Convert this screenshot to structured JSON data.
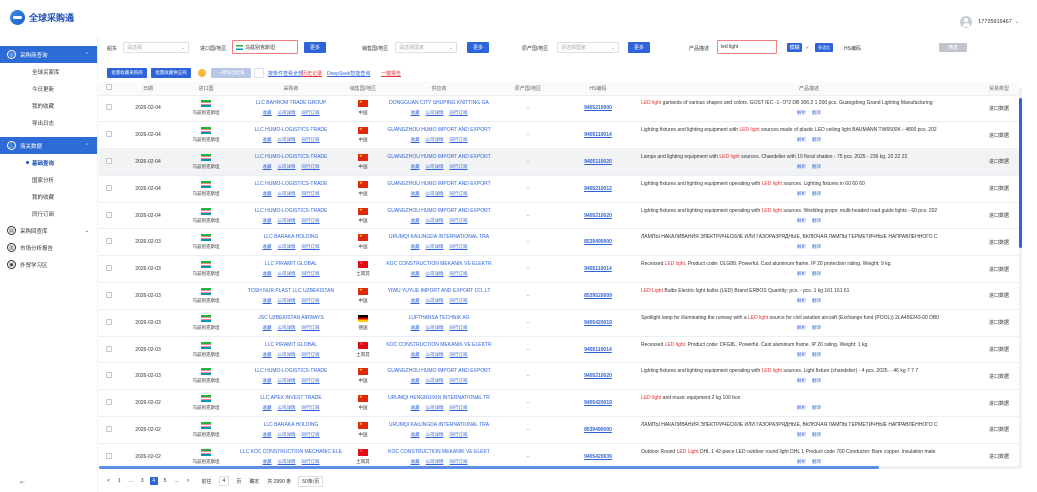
{
  "app": {
    "title": "全球采购通",
    "user_phone": "17725916467"
  },
  "sidebar": {
    "groups": [
      {
        "label": "采购商查询",
        "active": true,
        "items": [
          "全球买家库",
          "今日更新",
          "我的收藏",
          "导出日志"
        ]
      },
      {
        "label": "海关数据",
        "active": true,
        "items": [
          "基础查询",
          "国家分析",
          "我的收藏",
          "同行订阅"
        ]
      },
      {
        "label": "采购回查库"
      },
      {
        "label": "市场分析报告"
      },
      {
        "label": "外贸学习区"
      }
    ],
    "active_item": "基础查询",
    "footer_icon": "collapse-icon"
  },
  "filters": {
    "l1": "船东",
    "i1_ph": "请选择",
    "l2": "进口国/地区",
    "i2_val": "乌兹别克斯坦",
    "b2": "更多",
    "l3": "销售国/地区",
    "i3_ph": "请选择国家",
    "b3": "更多",
    "l4": "原产国/地区",
    "i4_ph": "请选择国家",
    "b4": "更多",
    "l5": "产品描述",
    "i5_val": "led light",
    "chip1": "模糊",
    "chip2": "多语言",
    "l6": "HS编码",
    "chip3": "筛选"
  },
  "toolbar": {
    "btn1": "批量收藏采购商",
    "btn2": "批量收藏供应商",
    "btn3": "一键导出结果",
    "link1": "按条件查看全部",
    "link2": "历史记录",
    "link3": "DeepSeek智能查询",
    "link4": "一键报告"
  },
  "table": {
    "headers": [
      "日期",
      "进口国",
      "采购商",
      "销售国/地区",
      "供应商",
      "原产国/地区",
      "HS编码",
      "产品描述",
      "贸易类型"
    ],
    "actions": [
      "收藏",
      "公司详情",
      "同行订阅"
    ],
    "desc_actions": [
      "解析",
      "翻译"
    ],
    "rows": [
      {
        "date": "2026-02-04",
        "imp": "乌兹别克斯坦",
        "buyer": "LLC BAHROM TRADE GROUP",
        "sc": "中国",
        "supplier": "DONGGUAN CITY SHUPING KNITTING GA",
        "oc": "-",
        "hs": "9405210000",
        "d1": "",
        "kw": "LED light",
        "d2": " garlands of various shapes and colors. GOST IEC -1- O*2 DB 306.2 1 200 pcs. Guangdong Grand Lighting Manufacturing",
        "type": "进口数据",
        "flag": "cn"
      },
      {
        "date": "2026-02-04",
        "imp": "乌兹别克斯坦",
        "buyer": "LLC HUMO-LOGISTICS-TRADE",
        "sc": "中国",
        "supplier": "GUANGZHOU HUMO IMPORT AND EXPORT",
        "oc": "-",
        "hs": "9405110014",
        "d1": "Lighting fixtures and lighting equipment with ",
        "kw": "LED light",
        "d2": " sources made of plastic LED ceiling light BAUMANN TW6500K - 4800 pcs. 202",
        "type": "进口数据",
        "flag": "cn"
      },
      {
        "date": "2026-02-04",
        "imp": "乌兹别克斯坦",
        "buyer": "LLC HUMO-LOGISTICS-TRADE",
        "sc": "中国",
        "supplier": "GUANGZHOU HUMO IMPORT AND EXPORT",
        "oc": "-",
        "hs": "9405110020",
        "d1": "Lamps and lighting equipment with ",
        "kw": "LED light",
        "d2": " sources. Chandelier with 10 floral shades - 75 pcs. 2025 - 236 kg. 22 22 22",
        "type": "进口数据",
        "flag": "cn"
      },
      {
        "date": "2026-02-04",
        "imp": "乌兹别克斯坦",
        "buyer": "LLC HUMO-LOGISTICS-TRADE",
        "sc": "中国",
        "supplier": "GUANGZHOU HUMO IMPORT AND EXPORT",
        "oc": "-",
        "hs": "9405210012",
        "d1": "Lighting fixtures and lighting equipment operating with ",
        "kw": "LED light",
        "d2": " sources. Lighting fixtures in 60 60 60",
        "type": "进口数据",
        "flag": "cn"
      },
      {
        "date": "2026-02-04",
        "imp": "乌兹别克斯坦",
        "buyer": "LLC HUMO-LOGISTICS-TRADE",
        "sc": "中国",
        "supplier": "GUANGZHOU HUMO IMPORT AND EXPORT",
        "oc": "-",
        "hs": "9405210020",
        "d1": "Lighting fixtures and lighting equipment operating with ",
        "kw": "LED light",
        "d2": " sources. Wedding props: multi-headed road guide lights - 60 pcs. 202",
        "type": "进口数据",
        "flag": "cn"
      },
      {
        "date": "2026-02-03",
        "imp": "乌兹别克斯坦",
        "buyer": "LLC BARAKA HOLDING",
        "sc": "中国",
        "supplier": "URUMQI KAILINGDA INTERNATIONAL TRA",
        "oc": "-",
        "hs": "8539490000",
        "d1": "ЛАМПЫ НАКАЛИВАНИЯ ЭЛЕКТРИЧЕСКИЕ ИЛИ ГАЗОРАЗРЯДНЫЕ, ВКЛЮЧАЯ ЛАМПЫ ГЕРМЕТИЧНЫЕ НАПРАВЛЕННОГО С",
        "kw": "",
        "d2": "",
        "type": "进口数据",
        "flag": "cn"
      },
      {
        "date": "2026-02-03",
        "imp": "乌兹别克斯坦",
        "buyer": "LLC PIRAMIT GLOBAL",
        "sc": "土耳其",
        "supplier": "KOC CONSTRUCTION MEKANIK VE ELEKTR",
        "oc": "-",
        "hs": "9405110014",
        "d1": "Recessed ",
        "kw": "LED light",
        "d2": ". Product code: DLG88. Powerful. Cast aluminum frame. IP 20 protection rating. Weight: 9 kg.",
        "type": "进口数据",
        "flag": "tr"
      },
      {
        "date": "2026-02-03",
        "imp": "乌兹别克斯坦",
        "buyer": "TOSH NUR PLAST LLC UZBEKISTAN",
        "sc": "中国",
        "supplier": "YIWU YUYUE IMPORT AND EXPORT CO.,LT",
        "oc": "-",
        "hs": "8539520009",
        "d1": "",
        "kw": "LED Light",
        "d2": " Bulbs Electric light bulbs (LED) Brand ERBOS Quantity: pcs. - pcs. 1 kg 161 161 61",
        "type": "进口数据",
        "flag": "cn"
      },
      {
        "date": "2026-02-03",
        "imp": "乌兹别克斯坦",
        "buyer": "JSC UZBEKISTAN AIRWAYS",
        "sc": "德国",
        "supplier": "LUFTHANSA TECHNIK AG",
        "oc": "-",
        "hs": "9405420019",
        "d1": "Spotlight lamp for illuminating the runway with a ",
        "kw": "LED light",
        "d2": " source for civil aviation aircraft (Exchange fund (POOL)) 2LA456243-00 DB0",
        "type": "进口数据",
        "flag": "de"
      },
      {
        "date": "2026-02-03",
        "imp": "乌兹别克斯坦",
        "buyer": "LLC PIRAMIT GLOBAL",
        "sc": "土耳其",
        "supplier": "KOC CONSTRUCTION MEKANIK VE ELEKTR",
        "oc": "-",
        "hs": "9405110014",
        "d1": "Recessed ",
        "kw": "LED light",
        "d2": ". Product code: DFG8L. Powerful. Cast aluminum frame. IP 20 rating. Weight: 1 kg.",
        "type": "进口数据",
        "flag": "tr"
      },
      {
        "date": "2026-02-03",
        "imp": "乌兹别克斯坦",
        "buyer": "LLC HUMO-LOGISTICS-TRADE",
        "sc": "中国",
        "supplier": "GUANGZHOU HUMO IMPORT AND EXPORT",
        "oc": "-",
        "hs": "9405210020",
        "d1": "Lighting fixtures and lighting equipment operating with ",
        "kw": "LED light",
        "d2": " sources. Light fixture (chandelier) - 4 pcs. 2025. - 46 kg 7 7 7",
        "type": "进口数据",
        "flag": "cn"
      },
      {
        "date": "2026-02-02",
        "imp": "乌兹别克斯坦",
        "buyer": "LLC APEX INVEST TRADE",
        "sc": "中国",
        "supplier": "URUMQI HENGRUIXIN INTERNATIONAL TR",
        "oc": "-",
        "hs": "9405420019",
        "d1": "",
        "kw": "LED light",
        "d2": " and music equipment 2 kg 100 box",
        "type": "进口数据",
        "flag": "cn"
      },
      {
        "date": "2026-02-02",
        "imp": "乌兹别克斯坦",
        "buyer": "LLC BARAKA HOLDING",
        "sc": "中国",
        "supplier": "URUMQI KAILINGDA INTERNATIONAL TRA",
        "oc": "-",
        "hs": "8539490000",
        "d1": "ЛАМПЫ НАКАЛИВАНИЯ ЭЛЕКТРИЧЕСКИЕ ИЛИ ГАЗОРАЗРЯДНЫЕ, ВКЛЮЧАЯ ЛАМПЫ ГЕРМЕТИЧНЫЕ НАПРАВЛЕННОГО С",
        "kw": "",
        "d2": "",
        "type": "进口数据",
        "flag": "cn"
      },
      {
        "date": "2026-02-02",
        "imp": "乌兹别克斯坦",
        "buyer": "LLC KOC CONSTRUCTION MECHANIC ELE",
        "sc": "土耳其",
        "supplier": "KOC CONSTRUCTION MEKANIK VE ELEKT",
        "oc": "-",
        "hs": "9405420039",
        "d1": "Outdoor Round ",
        "kw": "LED Light",
        "d2": " DHL 1 42-piece LED outdoor round light DHL 1 Product code 760 Conductor: Bare copper. Insulation mate",
        "type": "进口数据",
        "flag": "tr"
      }
    ]
  },
  "pager": {
    "prev": "<",
    "p1": "1",
    "dots1": "...",
    "p3": "3",
    "p4": "4",
    "p5": "5",
    "dots2": "...",
    "next": ">",
    "goto": "前往",
    "page_val": "4",
    "page_unit": "页",
    "confirm": "确定",
    "total": "共 2990 条",
    "size": "50条/页"
  }
}
